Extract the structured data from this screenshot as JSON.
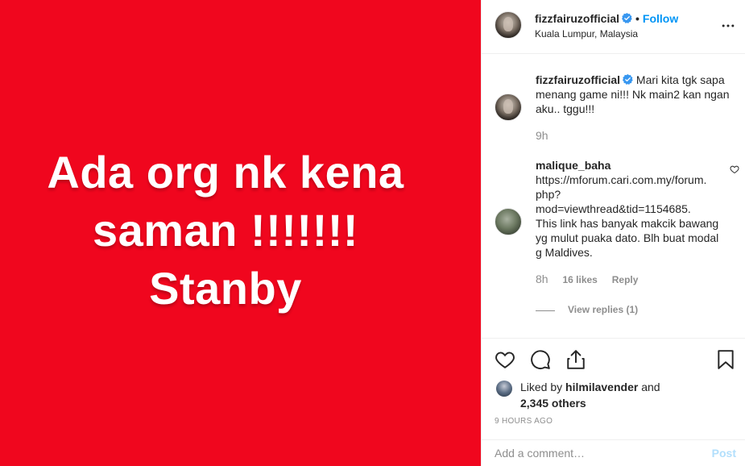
{
  "media": {
    "lines": [
      "Ada org nk kena",
      "saman !!!!!!!",
      "Stanby"
    ],
    "background_color": "#f0061e"
  },
  "header": {
    "username": "fizzfairuzofficial",
    "separator": "•",
    "follow_label": "Follow",
    "location": "Kuala Lumpur, Malaysia",
    "more_icon": "more-horizontal-icon"
  },
  "comments": [
    {
      "username": "fizzfairuzofficial",
      "text": "Mari kita tgk sapa menang game ni!!! Nk main2 kan ngan aku.. tggu!!!",
      "time": "9h",
      "verified": true
    },
    {
      "username": "malique_baha",
      "text": "https://mforum.cari.com.my/forum.php?mod=viewthread&tid=1154685. This link has banyak makcik bawang yg mulut puaka dato. Blh buat modal g Maldives.",
      "time": "8h",
      "likes": "16 likes",
      "reply_label": "Reply",
      "view_replies": "View replies (1)"
    }
  ],
  "actions": {
    "like_icon": "heart-icon",
    "comment_icon": "comment-icon",
    "share_icon": "share-icon",
    "save_icon": "bookmark-icon"
  },
  "likes": {
    "prefix": "Liked by",
    "user": "hilmilavender",
    "and": "and",
    "others": "2,345 others"
  },
  "timestamp": "9 HOURS AGO",
  "add_comment": {
    "placeholder": "Add a comment…",
    "post_label": "Post"
  },
  "colors": {
    "accent": "#0095f6",
    "post_disabled": "#b2dffc",
    "muted": "#8e8e8e"
  }
}
